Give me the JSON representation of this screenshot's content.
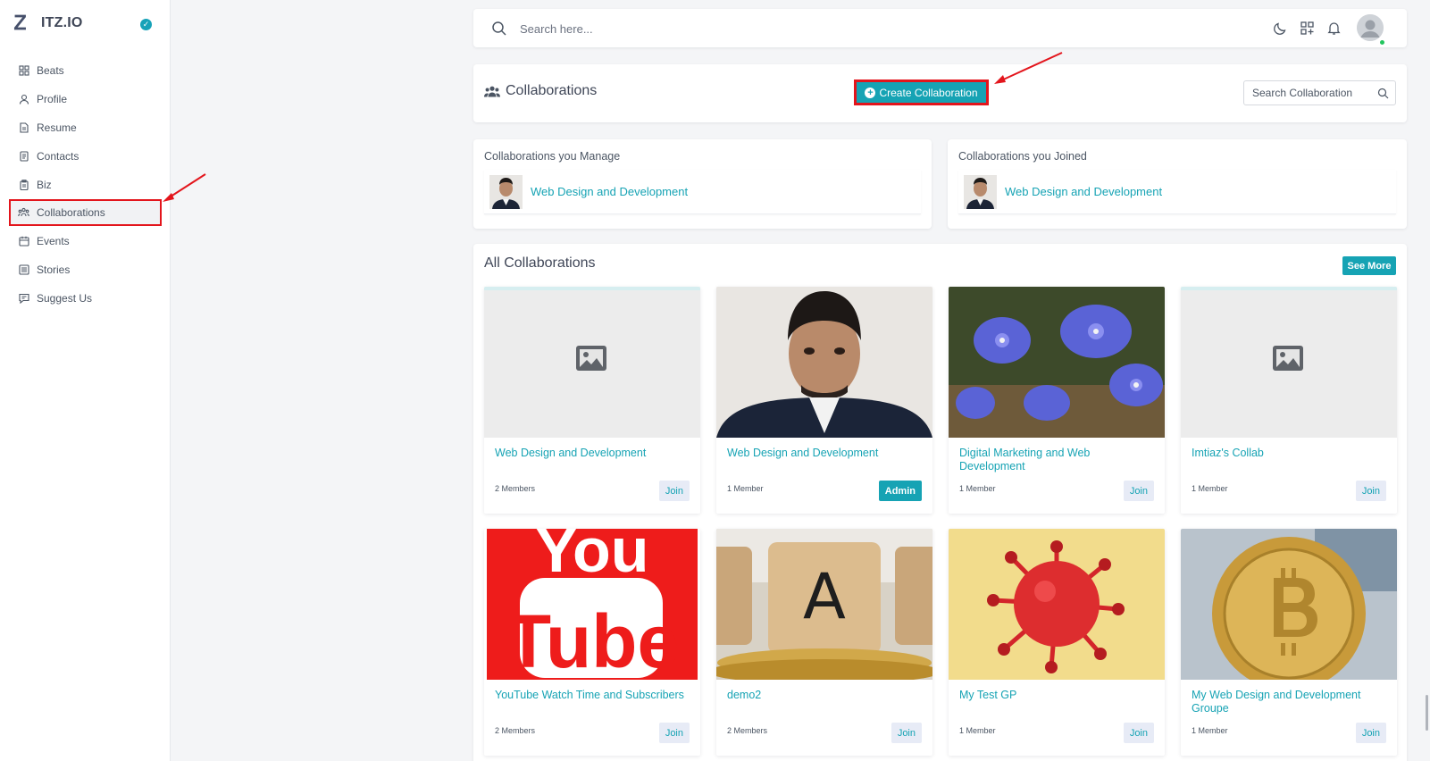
{
  "app": {
    "name": "ITZ.IO",
    "logo_glyph": "Ꮓ",
    "accent": "#16a3b4",
    "annotation_color": "#e3151c"
  },
  "sidebar": {
    "items": [
      {
        "label": "Beats",
        "icon": "grid-icon",
        "active": false
      },
      {
        "label": "Profile",
        "icon": "user-icon",
        "active": false
      },
      {
        "label": "Resume",
        "icon": "document-icon",
        "active": false
      },
      {
        "label": "Contacts",
        "icon": "contacts-icon",
        "active": false
      },
      {
        "label": "Biz",
        "icon": "clipboard-icon",
        "active": false
      },
      {
        "label": "Collaborations",
        "icon": "people-icon",
        "active": true
      },
      {
        "label": "Events",
        "icon": "calendar-icon",
        "active": false
      },
      {
        "label": "Stories",
        "icon": "list-icon",
        "active": false
      },
      {
        "label": "Suggest Us",
        "icon": "feedback-icon",
        "active": false
      }
    ]
  },
  "topbar": {
    "search_placeholder": "Search here..."
  },
  "header": {
    "title": "Collaborations",
    "create_label": "Create Collaboration",
    "search_placeholder": "Search Collaboration"
  },
  "manage": {
    "title": "Collaborations you Manage",
    "item": "Web Design and Development"
  },
  "joined": {
    "title": "Collaborations you Joined",
    "item": "Web Design and Development"
  },
  "all": {
    "title": "All Collaborations",
    "see_more": "See More",
    "tiles": [
      {
        "title": "Web Design and Development",
        "members": "2 Members",
        "action": "Join",
        "image": "placeholder"
      },
      {
        "title": "Web Design and Development",
        "members": "1 Member",
        "action": "Admin",
        "image": "person"
      },
      {
        "title": "Digital Marketing and Web Development",
        "members": "1 Member",
        "action": "Join",
        "image": "flowers"
      },
      {
        "title": "Imtiaz's Collab",
        "members": "1 Member",
        "action": "Join",
        "image": "placeholder"
      },
      {
        "title": "YouTube Watch Time and Subscribers",
        "members": "2 Members",
        "action": "Join",
        "image": "youtube",
        "image_text": [
          "You",
          "Tube"
        ]
      },
      {
        "title": "demo2",
        "members": "2 Members",
        "action": "Join",
        "image": "letter-block",
        "image_text": [
          "A"
        ]
      },
      {
        "title": "My Test GP",
        "members": "1 Member",
        "action": "Join",
        "image": "virus"
      },
      {
        "title": "My Web Design and Development Groupe",
        "members": "1 Member",
        "action": "Join",
        "image": "bitcoin"
      }
    ]
  }
}
